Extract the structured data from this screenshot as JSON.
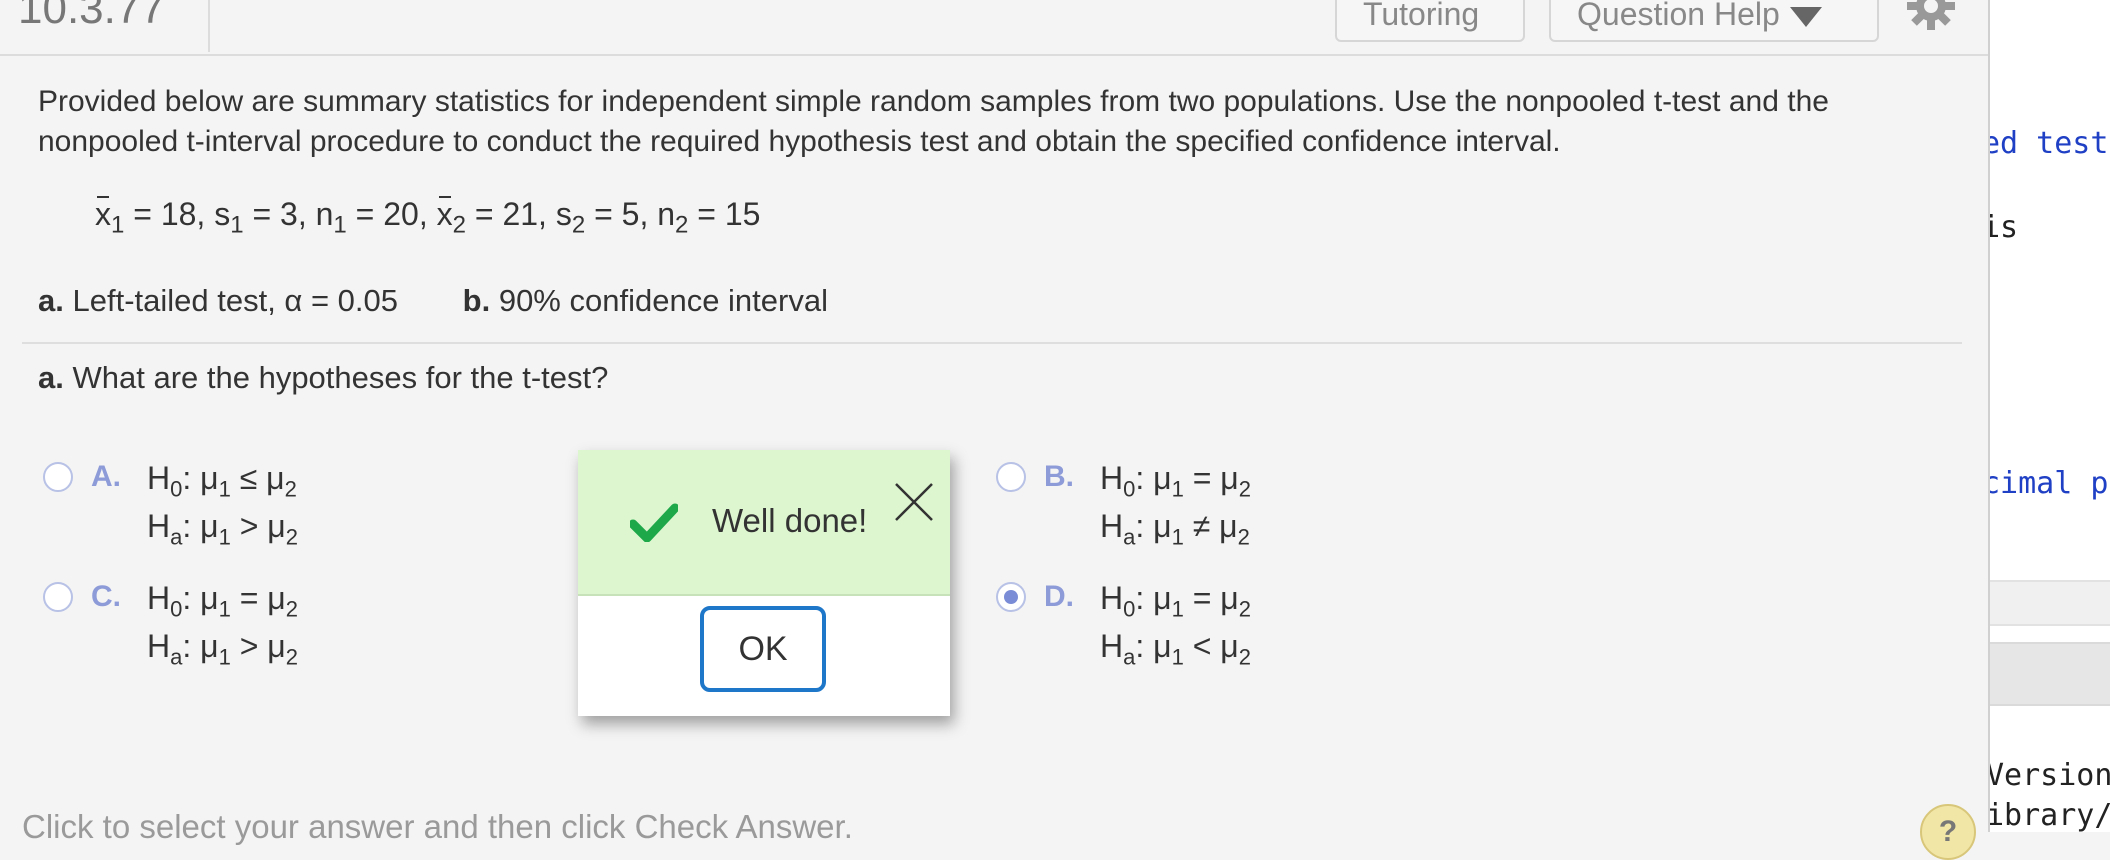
{
  "header": {
    "question_number": "10.3.77",
    "tutoring_label": "Tutoring",
    "help_label": "Question Help"
  },
  "prompt": "Provided below are summary statistics for independent simple random samples from two populations. Use the nonpooled t-test and the nonpooled t-interval procedure to conduct the required hypothesis test and obtain the specified confidence interval.",
  "stats": {
    "x1": "18",
    "s1": "3",
    "n1": "20",
    "x2": "21",
    "s2": "5",
    "n2": "15"
  },
  "parts": {
    "a_label": "a.",
    "a_text": "Left-tailed test, α = 0.05",
    "b_label": "b.",
    "b_text": "90% confidence interval"
  },
  "question": {
    "label": "a.",
    "text": "What are the hypotheses for the t-test?"
  },
  "options": [
    {
      "letter": "A.",
      "h0_rel": "≤",
      "ha_rel": ">",
      "selected": false
    },
    {
      "letter": "B.",
      "h0_rel": "=",
      "ha_rel": "≠",
      "selected": false
    },
    {
      "letter": "C.",
      "h0_rel": "=",
      "ha_rel": ">",
      "selected": false
    },
    {
      "letter": "D.",
      "h0_rel": "=",
      "ha_rel": "<",
      "selected": true
    }
  ],
  "dialog": {
    "message": "Well done!",
    "ok_label": "OK"
  },
  "footer": {
    "instruction": "Click to select your answer and then click Check Answer."
  },
  "side_panel": {
    "line1": "ed test",
    "line2": "is",
    "line3": "cimal p",
    "line4": "Version",
    "line5": "ibrary/"
  },
  "help_bubble": "?",
  "colors": {
    "accent_blue": "#1f77c9",
    "success_green": "#1ea84a",
    "success_bg": "#ddf6cf",
    "option_letter": "#8d9bd8"
  }
}
